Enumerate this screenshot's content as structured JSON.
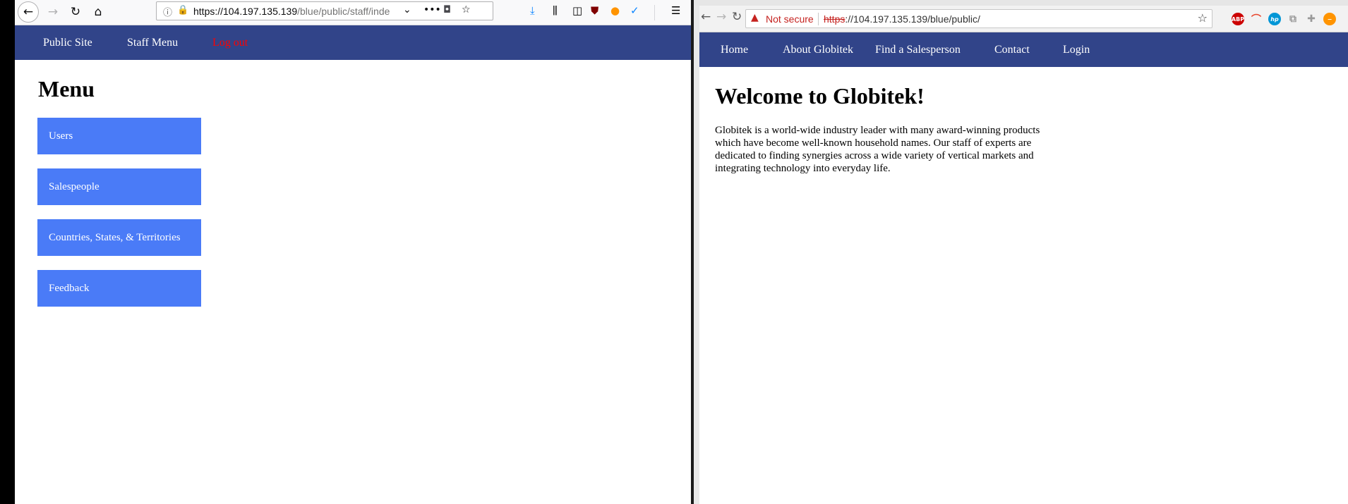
{
  "left_browser": {
    "url_host": "https://104.197.135.139",
    "url_path": "/blue/public/staff/inde",
    "nav": {
      "public_site": "Public Site",
      "staff_menu": "Staff Menu",
      "log_out": "Log out"
    },
    "page": {
      "title": "Menu",
      "menu_items": [
        "Users",
        "Salespeople",
        "Countries, States, & Territories",
        "Feedback"
      ]
    },
    "colors": {
      "nav_bg": "#314489",
      "button_bg": "#4a7bf7",
      "logout": "#ff0000"
    }
  },
  "right_browser": {
    "security_label": "Not secure",
    "url_scheme": "https",
    "url_rest": "://104.197.135.139/blue/public/",
    "extension_labels": {
      "adblock": "ABP",
      "hp": "hp"
    },
    "nav": [
      "Home",
      "About Globitek",
      "Find a Salesperson",
      "Contact",
      "Login"
    ],
    "page": {
      "heading": "Welcome to Globitek!",
      "intro": "Globitek is a world-wide industry leader with many award-winning products which have become well-known household names. Our staff of experts are dedicated to finding synergies across a wide variety of vertical markets and integrating technology into everyday life."
    }
  }
}
